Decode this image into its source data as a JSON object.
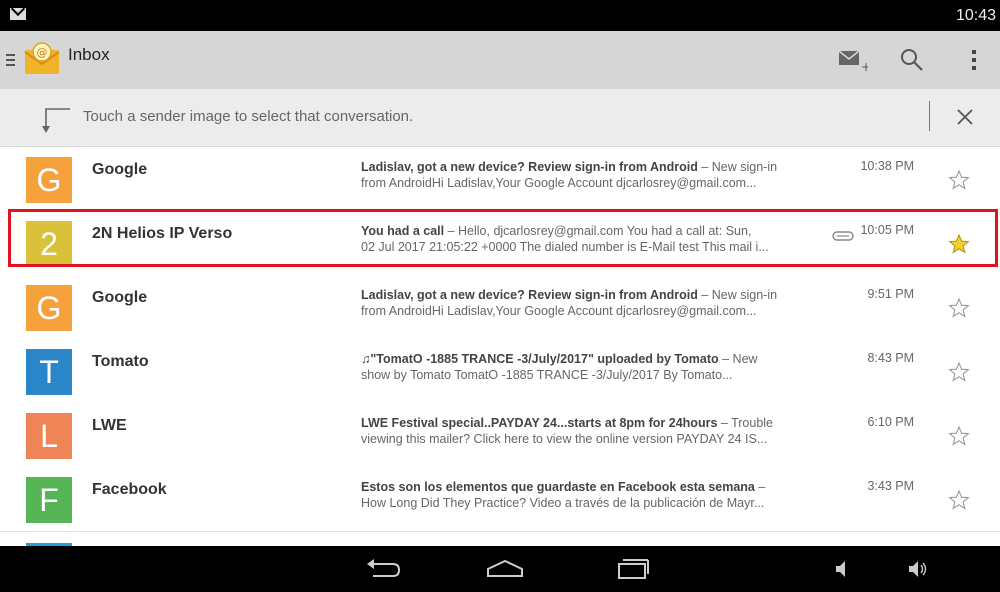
{
  "status_bar": {
    "time": "10:43",
    "notification_icon": "mail-notification-icon"
  },
  "action_bar": {
    "title": "Inbox",
    "actions": [
      {
        "name": "compose-mail-icon"
      },
      {
        "name": "search-icon"
      },
      {
        "name": "overflow-menu-icon"
      }
    ]
  },
  "hint": {
    "text": "Touch a sender image to select that conversation."
  },
  "messages": [
    {
      "letter": "G",
      "color": "#f5a23d",
      "sender": "Google",
      "subject": "Ladislav, got a new device? Review sign-in from Android",
      "preview1": " – New sign-in",
      "preview2": "from AndroidHi Ladislav,Your Google Account djcarlosrey@gmail.com...",
      "time": "10:38 PM",
      "starred": false,
      "attachment": false
    },
    {
      "letter": "2",
      "color": "#d9c23a",
      "sender": "2N Helios IP Verso",
      "subject": "You had a call",
      "preview1": " – Hello, djcarlosrey@gmail.com You had a call at: Sun,",
      "preview2": "02 Jul 2017 21:05:22 +0000 The dialed number is E-Mail test This mail i...",
      "time": "10:05 PM",
      "starred": true,
      "attachment": true
    },
    {
      "letter": "G",
      "color": "#f5a23d",
      "sender": "Google",
      "subject": "Ladislav, got a new device? Review sign-in from Android",
      "preview1": " – New sign-in",
      "preview2": "from AndroidHi Ladislav,Your Google Account djcarlosrey@gmail.com...",
      "time": "9:51 PM",
      "starred": false,
      "attachment": false
    },
    {
      "letter": "T",
      "color": "#2a86c8",
      "sender": "Tomato",
      "subject": "♫\"TomatO -1885 TRANCE -3/July/2017\" uploaded by Tomato",
      "preview1": " – New",
      "preview2": "show by Tomato TomatO -1885 TRANCE -3/July/2017 By Tomato...",
      "time": "8:43 PM",
      "starred": false,
      "attachment": false
    },
    {
      "letter": "L",
      "color": "#ef8456",
      "sender": "LWE",
      "subject": "LWE Festival special..PAYDAY 24...starts at 8pm for 24hours",
      "preview1": " – Trouble",
      "preview2": "viewing this mailer? Click here to view the online version PAYDAY 24 IS...",
      "time": "6:10 PM",
      "starred": false,
      "attachment": false
    },
    {
      "letter": "F",
      "color": "#56b556",
      "sender": "Facebook",
      "subject": "Estos son los elementos que guardaste en Facebook esta semana",
      "preview1": " –",
      "preview2": "How Long Did They Practice? Video a través de la publicación de Mayr...",
      "time": "3:43 PM",
      "starred": false,
      "attachment": false
    }
  ],
  "nav_bar": {
    "buttons": [
      {
        "name": "back-button"
      },
      {
        "name": "home-button"
      },
      {
        "name": "recent-apps-button"
      },
      {
        "name": "volume-down-button"
      },
      {
        "name": "volume-up-button"
      }
    ]
  },
  "colors": {
    "highlight": "#e0141e",
    "star_filled": "#f3d02e",
    "action_bar": "#d6d6d6",
    "hint_bg": "#ececec"
  }
}
